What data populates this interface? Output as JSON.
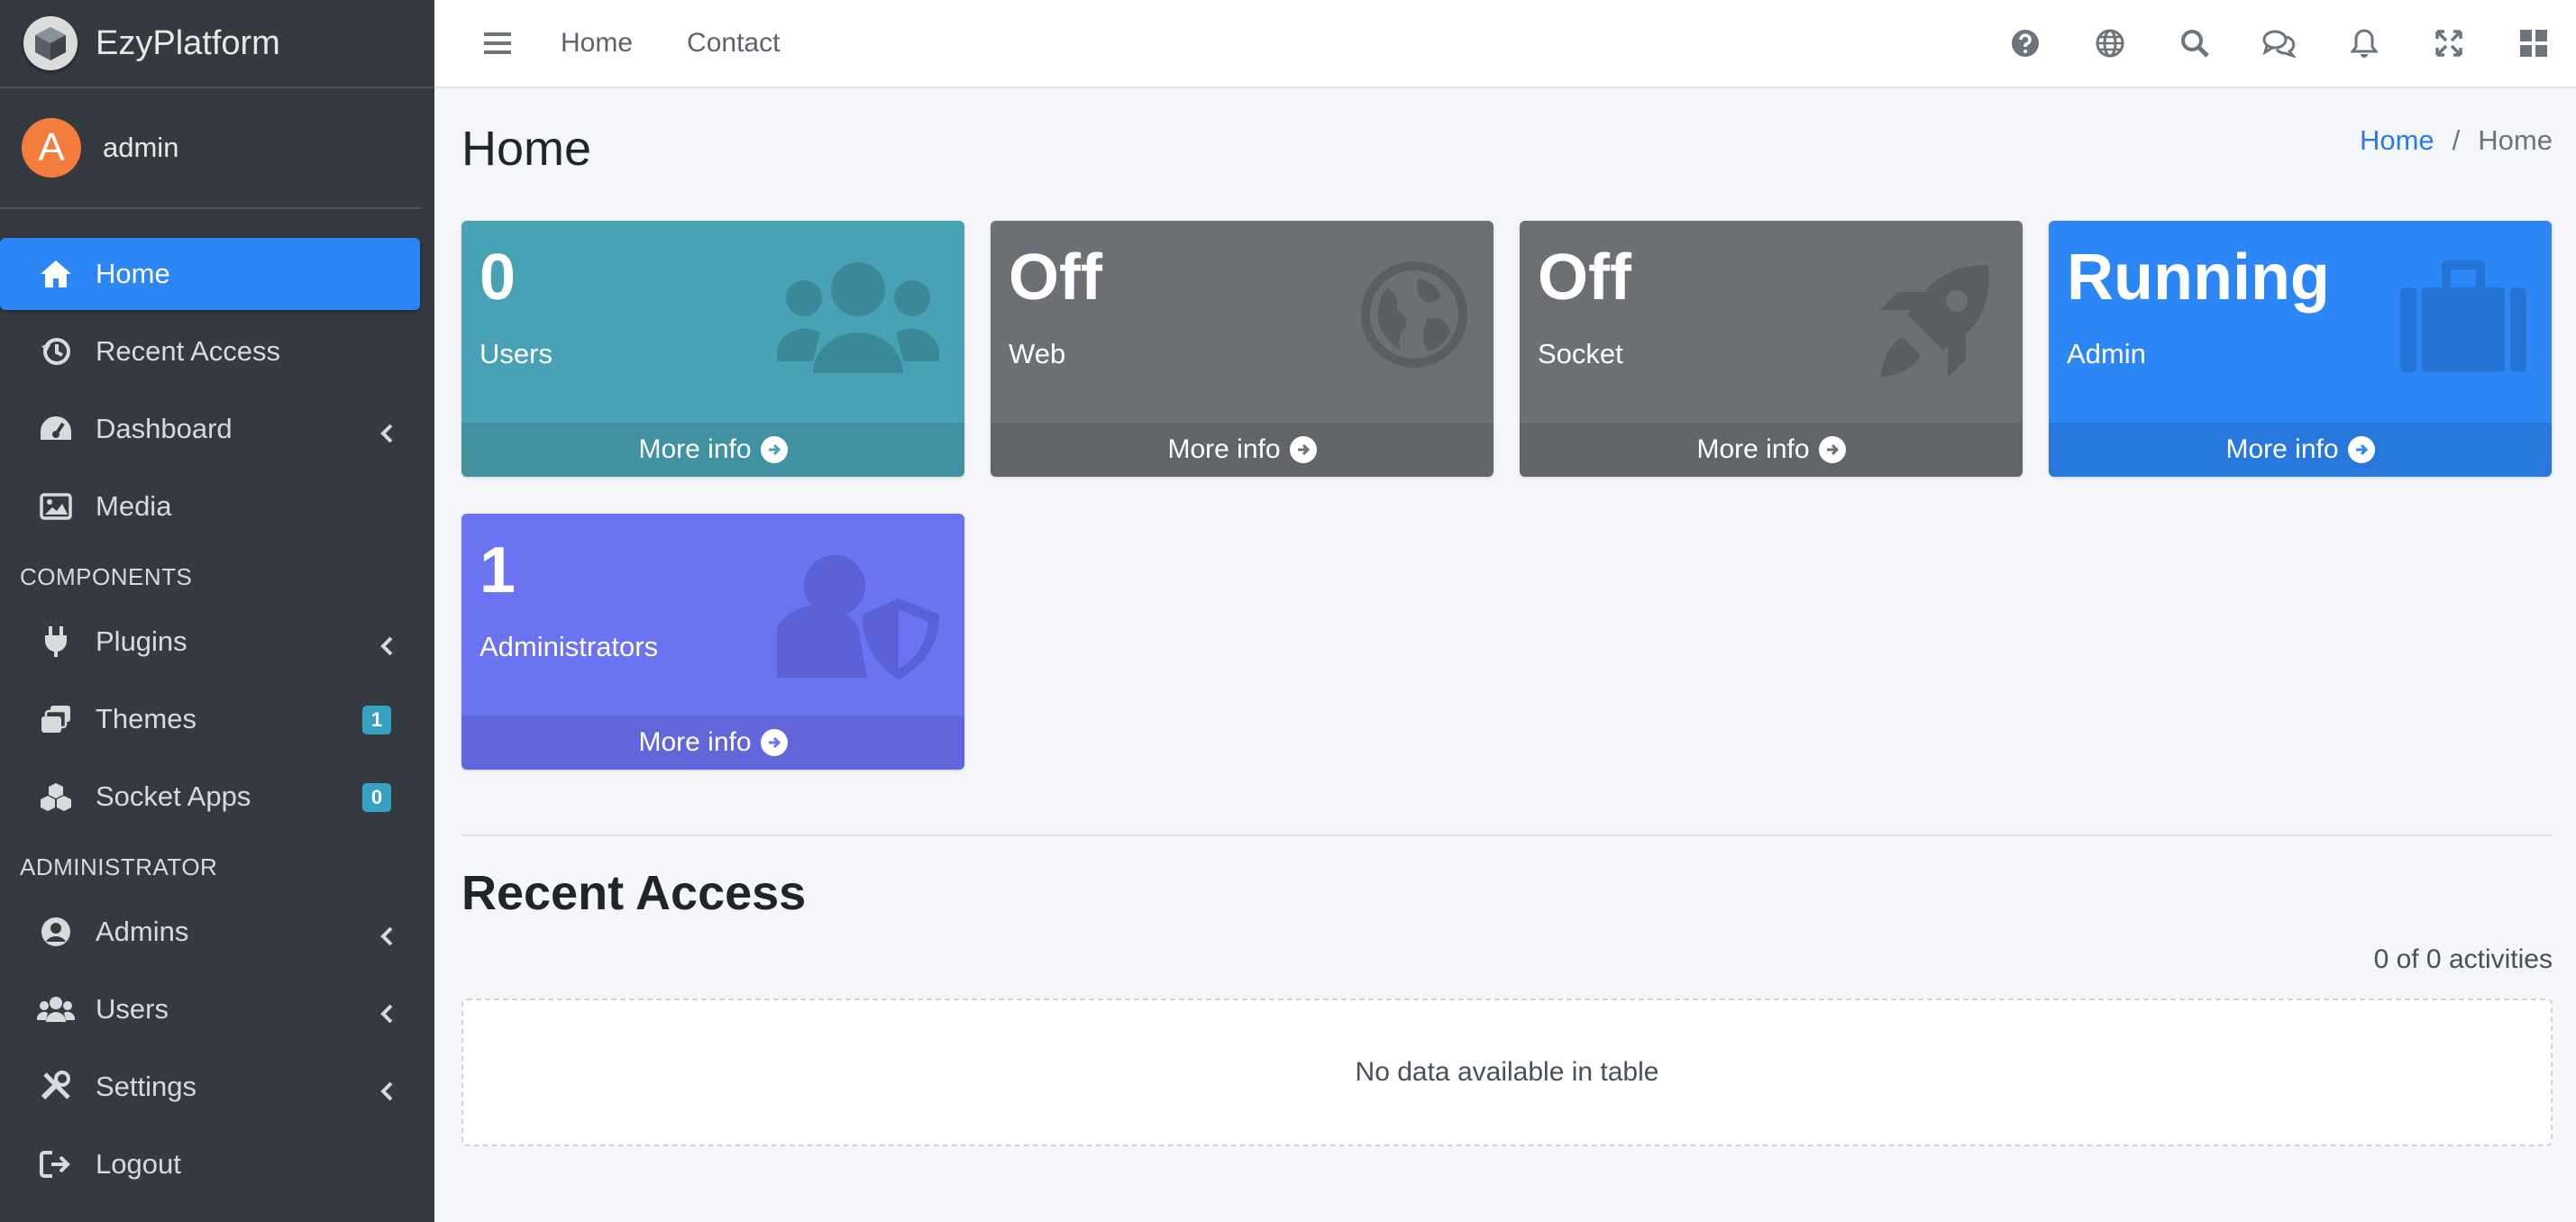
{
  "brand": {
    "name": "EzyPlatform"
  },
  "user": {
    "initial": "A",
    "name": "admin"
  },
  "sidebar": {
    "items": [
      {
        "label": "Home",
        "icon": "home-icon",
        "active": true
      },
      {
        "label": "Recent Access",
        "icon": "history-icon"
      },
      {
        "label": "Dashboard",
        "icon": "dashboard-icon",
        "chevron": true
      },
      {
        "label": "Media",
        "icon": "image-icon"
      }
    ],
    "components_header": "COMPONENTS",
    "components": [
      {
        "label": "Plugins",
        "icon": "plug-icon",
        "chevron": true
      },
      {
        "label": "Themes",
        "icon": "themes-icon",
        "badge": "1"
      },
      {
        "label": "Socket Apps",
        "icon": "cubes-icon",
        "badge": "0"
      }
    ],
    "admin_header": "ADMINISTRATOR",
    "admin": [
      {
        "label": "Admins",
        "icon": "user-circle-icon",
        "chevron": true
      },
      {
        "label": "Users",
        "icon": "users-icon",
        "chevron": true
      },
      {
        "label": "Settings",
        "icon": "tools-icon",
        "chevron": true
      },
      {
        "label": "Logout",
        "icon": "logout-icon"
      }
    ]
  },
  "topbar": {
    "links": [
      "Home",
      "Contact"
    ],
    "icons": [
      "help-icon",
      "globe-icon",
      "search-icon",
      "messages-icon",
      "bell-icon",
      "fullscreen-icon",
      "apps-grid-icon"
    ]
  },
  "page": {
    "title": "Home",
    "breadcrumb": [
      "Home",
      "Home"
    ]
  },
  "boxes": [
    {
      "value": "0",
      "label": "Users",
      "more": "More info",
      "color": "#48a2b5",
      "icon": "users-icon"
    },
    {
      "value": "Off",
      "label": "Web",
      "more": "More info",
      "color": "#6c7075",
      "icon": "globe-icon"
    },
    {
      "value": "Off",
      "label": "Socket",
      "more": "More info",
      "color": "#6c7075",
      "icon": "rocket-icon"
    },
    {
      "value": "Running",
      "label": "Admin",
      "more": "More info",
      "color": "#2c86f5",
      "icon": "suitcase-icon"
    },
    {
      "value": "1",
      "label": "Administrators",
      "more": "More info",
      "color": "#6c73f3",
      "icon": "user-shield-icon"
    }
  ],
  "recent": {
    "title": "Recent Access",
    "count": "0 of 0 activities",
    "empty": "No data available in table"
  }
}
